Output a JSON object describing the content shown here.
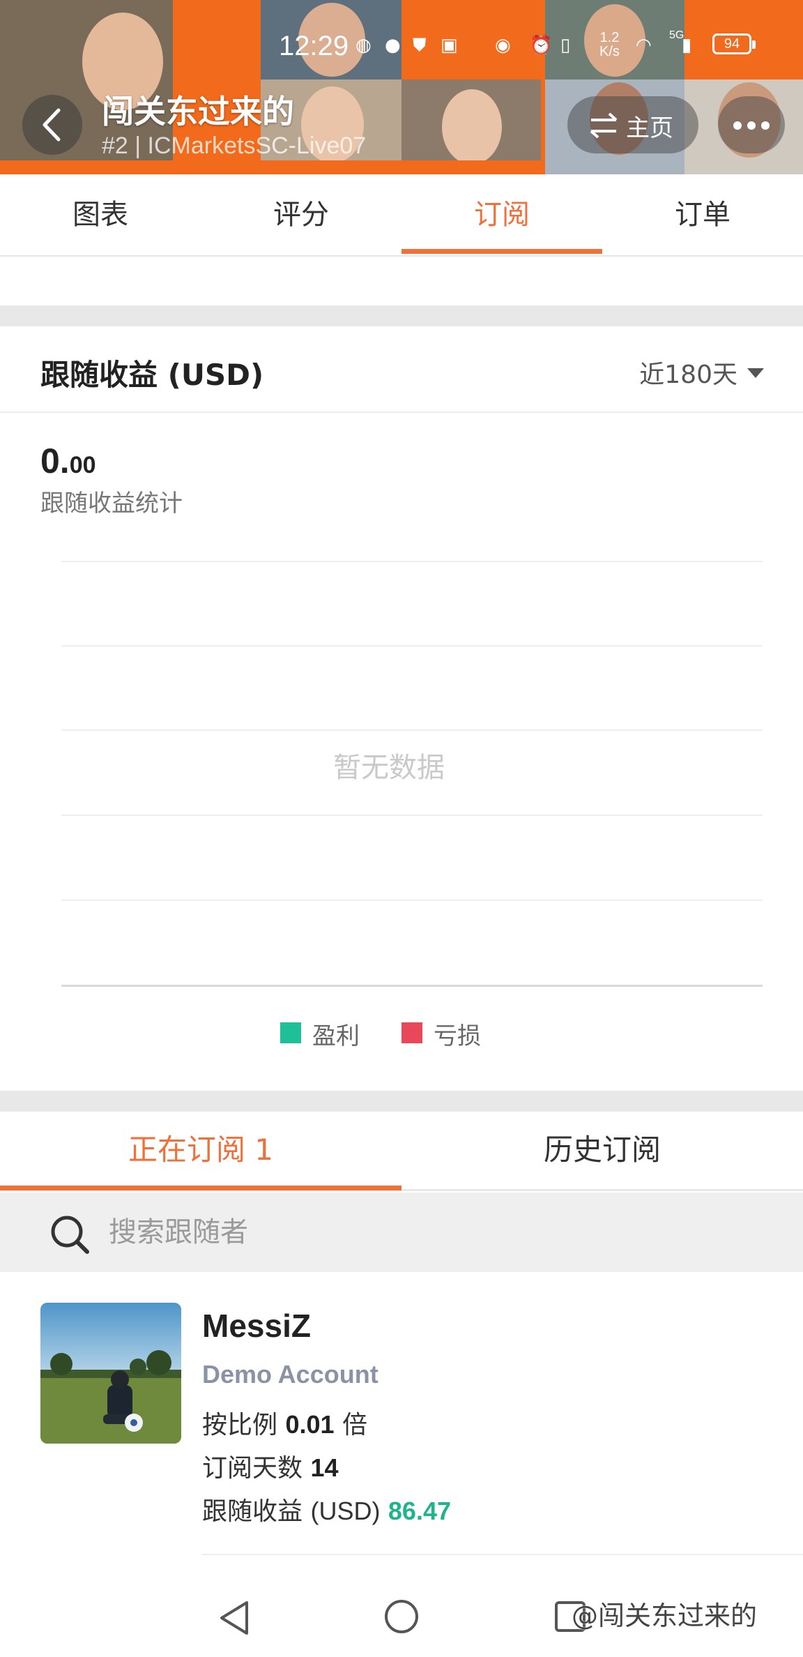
{
  "status_bar": {
    "time": "12:29",
    "net_speed_top": "1.2",
    "net_speed_unit": "K/s",
    "signal": "5G",
    "battery": "94",
    "icons": [
      "browser-icon",
      "chat-icon",
      "shield-icon",
      "app-icon",
      "eye-icon",
      "alarm-icon",
      "vibrate-icon",
      "wifi-icon",
      "signal-icon",
      "battery-icon"
    ]
  },
  "header": {
    "title": "闯关东过来的",
    "subtitle": "#2 | ICMarketsSC-Live07",
    "home_label": "主页",
    "accent_color": "#f26a1b"
  },
  "tabs": [
    {
      "label": "图表",
      "active": false
    },
    {
      "label": "评分",
      "active": false
    },
    {
      "label": "订阅",
      "active": true
    },
    {
      "label": "订单",
      "active": false
    }
  ],
  "earnings": {
    "title": "跟随收益 (USD)",
    "period": "近180天",
    "value_int": "0.",
    "value_dec": "00",
    "stat_label": "跟随收益统计",
    "empty_text": "暂无数据",
    "legend": [
      {
        "label": "盈利",
        "color": "#1fbf97"
      },
      {
        "label": "亏损",
        "color": "#e8495a"
      }
    ]
  },
  "subscriptions": {
    "tabs": [
      {
        "label": "正在订阅 1",
        "active": true
      },
      {
        "label": "历史订阅",
        "active": false
      }
    ],
    "search_placeholder": "搜索跟随者",
    "followers": [
      {
        "name": "MessiZ",
        "account": "Demo Account",
        "ratio_prefix": "按比例",
        "ratio_value": "0.01",
        "ratio_suffix": "倍",
        "days_label": "订阅天数",
        "days_value": "14",
        "profit_label": "跟随收益",
        "profit_unit": "(USD)",
        "profit_value": "86.47",
        "profit_color": "#1fb38e"
      }
    ]
  },
  "watermark": "@闯关东过来的"
}
